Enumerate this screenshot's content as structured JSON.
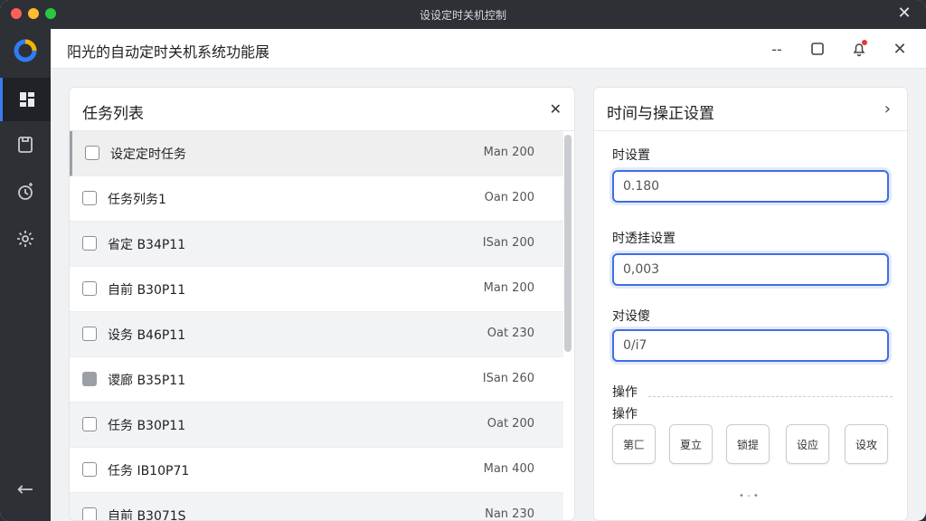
{
  "window": {
    "title": "设设定时关机控制"
  },
  "rail": {
    "items": [
      {
        "icon": "dashboard-icon",
        "active": true
      },
      {
        "icon": "task-icon",
        "active": false
      },
      {
        "icon": "timer-icon",
        "active": false
      },
      {
        "icon": "gear-icon",
        "active": false
      }
    ],
    "back_icon": "arrow-left-icon"
  },
  "header": {
    "title": "阳光的自动定时关机系统功能展",
    "min_label": "--",
    "max_label": "☐",
    "bell_icon": "bell-icon",
    "close_label": "✕"
  },
  "tasks": {
    "title": "任务列表",
    "close_label": "✕",
    "rows": [
      {
        "name": "设定定时任务",
        "time": "Man 200",
        "checked": false
      },
      {
        "name": "任务列务1",
        "time": "Oan 200",
        "checked": false
      },
      {
        "name": "省定 B34P11",
        "time": "ISan 200",
        "checked": false
      },
      {
        "name": "自前 B30P11",
        "time": "Man 200",
        "checked": false
      },
      {
        "name": "设务 B46P11",
        "time": "Oat 230",
        "checked": false
      },
      {
        "name": "谡廊 B35P11",
        "time": "ISan 260",
        "checked": true
      },
      {
        "name": "任务 B30P11",
        "time": "Oat 200",
        "checked": false
      },
      {
        "name": "任务 IB10P71",
        "time": "Man 400",
        "checked": false
      },
      {
        "name": "自前 B3071S",
        "time": "Nan 230",
        "checked": false
      }
    ]
  },
  "settings": {
    "title": "时间与操正设置",
    "chevron": "›",
    "fields": [
      {
        "label": "时设置",
        "value": "0.180"
      },
      {
        "label": "时透挂设置",
        "value": "0,003"
      },
      {
        "label": "对设傻",
        "value": "0/i7"
      }
    ],
    "ops_label_1": "操作",
    "ops_label_2": "操作",
    "ops": [
      "第匚",
      "夏立",
      "锁提",
      "设应",
      "设攻"
    ],
    "pager": "• - •"
  }
}
